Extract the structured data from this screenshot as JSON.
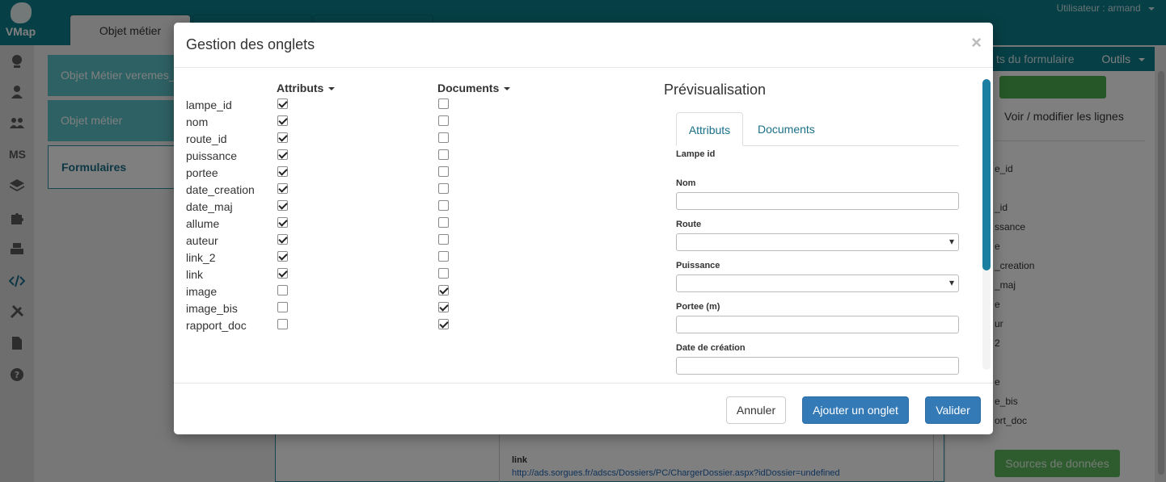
{
  "app": {
    "logo_text": "VMap",
    "user_label": "Utilisateur : armand",
    "active_tab": "Objet métier"
  },
  "sidebar": {
    "icons": [
      "globe-icon",
      "user-icon",
      "users-icon",
      "ms-icon",
      "layers-icon",
      "puzzle-icon",
      "printer-icon",
      "code-icon",
      "tools-icon",
      "document-icon",
      "help-icon"
    ],
    "ms_label": "MS"
  },
  "left_list": [
    "Objet Métier veremes_",
    "Objet métier",
    "Formulaires"
  ],
  "right_panel": {
    "title": "ts du formulaire",
    "tools": "Outils",
    "voir": "Voir / modifier les lignes",
    "fields": [
      "e_id",
      "_id",
      "ssance",
      "e",
      "_creation",
      "_maj",
      "e",
      "ur",
      "2",
      "e",
      "e_bis",
      "ort_doc"
    ],
    "sources": "Sources de données"
  },
  "background": {
    "link_label": "link",
    "link_value": "http://ads.sorgues.fr/adscs/Dossiers/PC/ChargerDossier.aspx?idDossier=undefined"
  },
  "modal": {
    "title": "Gestion des onglets",
    "close": "×",
    "col_attributs": "Attributs",
    "col_documents": "Documents",
    "fields": [
      {
        "name": "lampe_id",
        "attr": true,
        "doc": false
      },
      {
        "name": "nom",
        "attr": true,
        "doc": false
      },
      {
        "name": "route_id",
        "attr": true,
        "doc": false
      },
      {
        "name": "puissance",
        "attr": true,
        "doc": false
      },
      {
        "name": "portee",
        "attr": true,
        "doc": false
      },
      {
        "name": "date_creation",
        "attr": true,
        "doc": false
      },
      {
        "name": "date_maj",
        "attr": true,
        "doc": false
      },
      {
        "name": "allume",
        "attr": true,
        "doc": false
      },
      {
        "name": "auteur",
        "attr": true,
        "doc": false
      },
      {
        "name": "link_2",
        "attr": true,
        "doc": false
      },
      {
        "name": "link",
        "attr": true,
        "doc": false
      },
      {
        "name": "image",
        "attr": false,
        "doc": true
      },
      {
        "name": "image_bis",
        "attr": false,
        "doc": true
      },
      {
        "name": "rapport_doc",
        "attr": false,
        "doc": true
      }
    ],
    "preview": {
      "title": "Prévisualisation",
      "tab_attributs": "Attributs",
      "tab_documents": "Documents",
      "labels": {
        "lampe_id": "Lampe id",
        "nom": "Nom",
        "route": "Route",
        "puissance": "Puissance",
        "portee": "Portee (m)",
        "date_creation": "Date de création"
      }
    },
    "buttons": {
      "annuler": "Annuler",
      "ajouter": "Ajouter un onglet",
      "valider": "Valider"
    }
  }
}
